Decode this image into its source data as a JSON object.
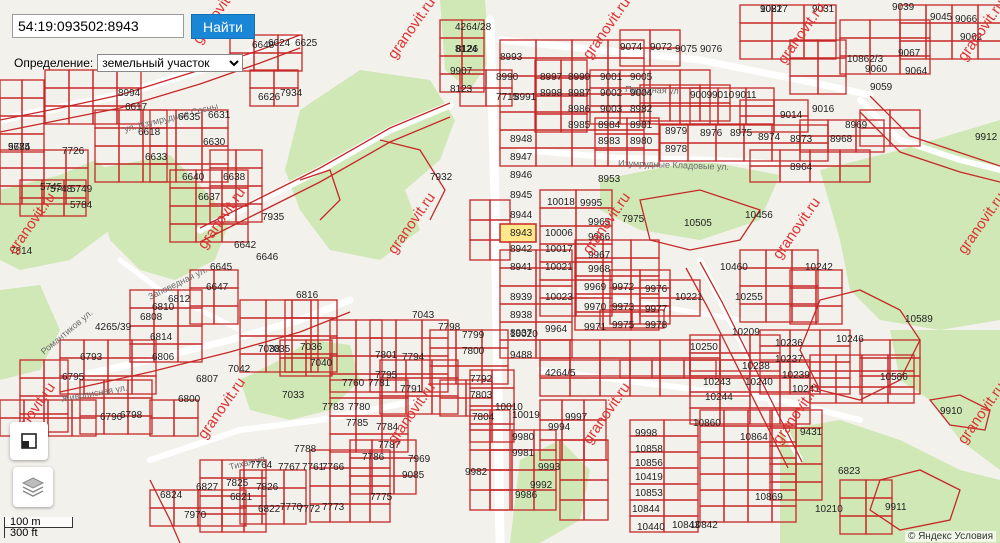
{
  "search": {
    "value": "54:19:093502:8943",
    "button_label": "Найти"
  },
  "definition": {
    "label": "Определение:",
    "selected": "земельный участок"
  },
  "scale": {
    "primary": "100 m",
    "secondary": "300 ft"
  },
  "attribution": "© Яндекс  Условия",
  "watermark": "granovit.ru",
  "highlight_parcel": "8943",
  "colors": {
    "parcel_stroke": "#c62828",
    "highlight": "#ffe98a",
    "forest": "#cfe8b6",
    "road": "#ffffff",
    "search_button": "#1a86d6"
  },
  "streets": [
    "ул. Изумрудные Сосны",
    "Парадная ул.",
    "Изумрудные Кладовые ул.",
    "Романтиков ул.",
    "Живописная ул.",
    "Заповедная ул.",
    "Тихая ул."
  ],
  "map_labels": [
    {
      "text": "9021"
    },
    {
      "text": "9031"
    },
    {
      "text": "9039"
    },
    {
      "text": "9045"
    },
    {
      "text": "9066"
    },
    {
      "text": "9062"
    },
    {
      "text": "9067"
    },
    {
      "text": "9064"
    },
    {
      "text": "9060"
    },
    {
      "text": "9059"
    },
    {
      "text": "9074"
    },
    {
      "text": "9072"
    },
    {
      "text": "9075"
    },
    {
      "text": "9076"
    },
    {
      "text": "9001"
    },
    {
      "text": "9002"
    },
    {
      "text": "9003"
    },
    {
      "text": "9004"
    },
    {
      "text": "9005"
    },
    {
      "text": "9009"
    },
    {
      "text": "9010"
    },
    {
      "text": "9011"
    },
    {
      "text": "9014"
    },
    {
      "text": "9016"
    },
    {
      "text": "8997"
    },
    {
      "text": "8998"
    },
    {
      "text": "8999"
    },
    {
      "text": "8987"
    },
    {
      "text": "8986"
    },
    {
      "text": "8985"
    },
    {
      "text": "8984"
    },
    {
      "text": "8983"
    },
    {
      "text": "8982"
    },
    {
      "text": "8981"
    },
    {
      "text": "8980"
    },
    {
      "text": "8979"
    },
    {
      "text": "8978"
    },
    {
      "text": "8976"
    },
    {
      "text": "8975"
    },
    {
      "text": "8974"
    },
    {
      "text": "8973"
    },
    {
      "text": "8969"
    },
    {
      "text": "8968"
    },
    {
      "text": "8964"
    },
    {
      "text": "8953"
    },
    {
      "text": "8948"
    },
    {
      "text": "8947"
    },
    {
      "text": "8946"
    },
    {
      "text": "8945"
    },
    {
      "text": "8944"
    },
    {
      "text": "8943"
    },
    {
      "text": "8942"
    },
    {
      "text": "8941"
    },
    {
      "text": "8939"
    },
    {
      "text": "8938"
    },
    {
      "text": "8937"
    },
    {
      "text": "9488"
    },
    {
      "text": "10020"
    },
    {
      "text": "10006"
    },
    {
      "text": "10017"
    },
    {
      "text": "10021"
    },
    {
      "text": "10023"
    },
    {
      "text": "10018"
    },
    {
      "text": "9995"
    },
    {
      "text": "9965"
    },
    {
      "text": "9966"
    },
    {
      "text": "9967"
    },
    {
      "text": "9968"
    },
    {
      "text": "9969"
    },
    {
      "text": "9970"
    },
    {
      "text": "9971"
    },
    {
      "text": "9964"
    },
    {
      "text": "9972"
    },
    {
      "text": "9973"
    },
    {
      "text": "9975"
    },
    {
      "text": "9976"
    },
    {
      "text": "9977"
    },
    {
      "text": "9978"
    },
    {
      "text": "10221"
    },
    {
      "text": "7975"
    },
    {
      "text": "10505"
    },
    {
      "text": "10456"
    },
    {
      "text": "10460"
    },
    {
      "text": "10242"
    },
    {
      "text": "10255"
    },
    {
      "text": "10250"
    },
    {
      "text": "10209"
    },
    {
      "text": "10236"
    },
    {
      "text": "10237"
    },
    {
      "text": "10238"
    },
    {
      "text": "10239"
    },
    {
      "text": "10240"
    },
    {
      "text": "10241"
    },
    {
      "text": "10243"
    },
    {
      "text": "10244"
    },
    {
      "text": "10246"
    },
    {
      "text": "10586"
    },
    {
      "text": "10589"
    },
    {
      "text": "9910"
    },
    {
      "text": "9911"
    },
    {
      "text": "9912"
    },
    {
      "text": "4264/5"
    },
    {
      "text": "10010"
    },
    {
      "text": "10019"
    },
    {
      "text": "9980"
    },
    {
      "text": "9981"
    },
    {
      "text": "9982"
    },
    {
      "text": "9986"
    },
    {
      "text": "9992"
    },
    {
      "text": "9993"
    },
    {
      "text": "9994"
    },
    {
      "text": "9997"
    },
    {
      "text": "9998"
    },
    {
      "text": "10860"
    },
    {
      "text": "10858"
    },
    {
      "text": "10856"
    },
    {
      "text": "10419"
    },
    {
      "text": "10853"
    },
    {
      "text": "10844"
    },
    {
      "text": "10440"
    },
    {
      "text": "10843"
    },
    {
      "text": "10842"
    },
    {
      "text": "10869"
    },
    {
      "text": "10864"
    },
    {
      "text": "9431"
    },
    {
      "text": "10210"
    },
    {
      "text": "9907"
    },
    {
      "text": "8123"
    },
    {
      "text": "8124"
    },
    {
      "text": "7715"
    },
    {
      "text": "8990"
    },
    {
      "text": "8991"
    },
    {
      "text": "8993"
    },
    {
      "text": "8994"
    },
    {
      "text": "6617"
    },
    {
      "text": "6618"
    },
    {
      "text": "6633"
    },
    {
      "text": "6635"
    },
    {
      "text": "6631"
    },
    {
      "text": "6630"
    },
    {
      "text": "6640"
    },
    {
      "text": "6637"
    },
    {
      "text": "6638"
    },
    {
      "text": "6642"
    },
    {
      "text": "6646"
    },
    {
      "text": "6645"
    },
    {
      "text": "6647"
    },
    {
      "text": "6648"
    },
    {
      "text": "6624"
    },
    {
      "text": "6625"
    },
    {
      "text": "6626"
    },
    {
      "text": "7934"
    },
    {
      "text": "7935"
    },
    {
      "text": "7932"
    },
    {
      "text": "7726"
    },
    {
      "text": "9674"
    },
    {
      "text": "5745"
    },
    {
      "text": "5748"
    },
    {
      "text": "5749"
    },
    {
      "text": "5784"
    },
    {
      "text": "5785"
    },
    {
      "text": "7814"
    },
    {
      "text": "4265/39"
    },
    {
      "text": "6793"
    },
    {
      "text": "6808"
    },
    {
      "text": "6810"
    },
    {
      "text": "6812"
    },
    {
      "text": "6814"
    },
    {
      "text": "6806"
    },
    {
      "text": "6807"
    },
    {
      "text": "6800"
    },
    {
      "text": "6798"
    },
    {
      "text": "6796"
    },
    {
      "text": "6795"
    },
    {
      "text": "6816"
    },
    {
      "text": "7038"
    },
    {
      "text": "7035"
    },
    {
      "text": "7036"
    },
    {
      "text": "7040"
    },
    {
      "text": "7042"
    },
    {
      "text": "7033"
    },
    {
      "text": "7043"
    },
    {
      "text": "7798"
    },
    {
      "text": "7799"
    },
    {
      "text": "7800"
    },
    {
      "text": "7801"
    },
    {
      "text": "7794"
    },
    {
      "text": "7795"
    },
    {
      "text": "7791"
    },
    {
      "text": "7792"
    },
    {
      "text": "7803"
    },
    {
      "text": "7804"
    },
    {
      "text": "7760"
    },
    {
      "text": "7781"
    },
    {
      "text": "7783"
    },
    {
      "text": "7780"
    },
    {
      "text": "7785"
    },
    {
      "text": "7784"
    },
    {
      "text": "7787"
    },
    {
      "text": "7786"
    },
    {
      "text": "7788"
    },
    {
      "text": "7761"
    },
    {
      "text": "7766"
    },
    {
      "text": "7767"
    },
    {
      "text": "7764"
    },
    {
      "text": "7826"
    },
    {
      "text": "7825"
    },
    {
      "text": "6821"
    },
    {
      "text": "6822"
    },
    {
      "text": "7770"
    },
    {
      "text": "7772"
    },
    {
      "text": "7773"
    },
    {
      "text": "7775"
    },
    {
      "text": "9085"
    },
    {
      "text": "7969"
    },
    {
      "text": "7970"
    },
    {
      "text": "6824"
    },
    {
      "text": "6827"
    },
    {
      "text": "6823"
    },
    {
      "text": "10862/3"
    },
    {
      "text": "4264/28"
    },
    {
      "text": "8126"
    },
    {
      "text": "10827"
    }
  ]
}
